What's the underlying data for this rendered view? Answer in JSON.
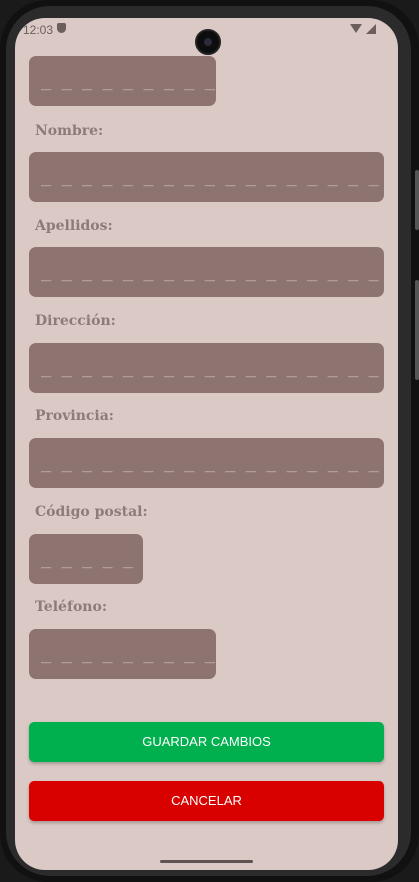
{
  "status_bar": {
    "time": "12:03"
  },
  "form": {
    "top_field": {
      "value": "_ _ _ _ _ _ _ _ _"
    },
    "nombre": {
      "label": "Nombre:",
      "value": "_ _ _ _ _ _ _ _ _ _ _ _ _ _ _ _ _ _ _ _"
    },
    "apellidos": {
      "label": "Apellidos:",
      "value": "_ _ _ _ _ _ _ _ _ _ _ _ _ _ _ _ _ _ _ _"
    },
    "direccion": {
      "label": "Dirección:",
      "value": "_ _ _ _ _ _ _ _ _ _ _ _ _ _ _ _ _ _ _ _"
    },
    "provincia": {
      "label": "Provincia:",
      "value": "_ _ _ _ _ _ _ _ _ _ _ _ _ _ _ _ _ _ _ _"
    },
    "codigo_postal": {
      "label": "Código postal:",
      "value": "_ _ _ _ _"
    },
    "telefono": {
      "label": "Teléfono:",
      "value": "_ _ _ _ _ _ _ _ _"
    }
  },
  "buttons": {
    "save": "GUARDAR CAMBIOS",
    "cancel": "CANCELAR"
  },
  "colors": {
    "background": "#dbc9c6",
    "field": "#8e7470",
    "save": "#00b04f",
    "cancel": "#d90000"
  }
}
